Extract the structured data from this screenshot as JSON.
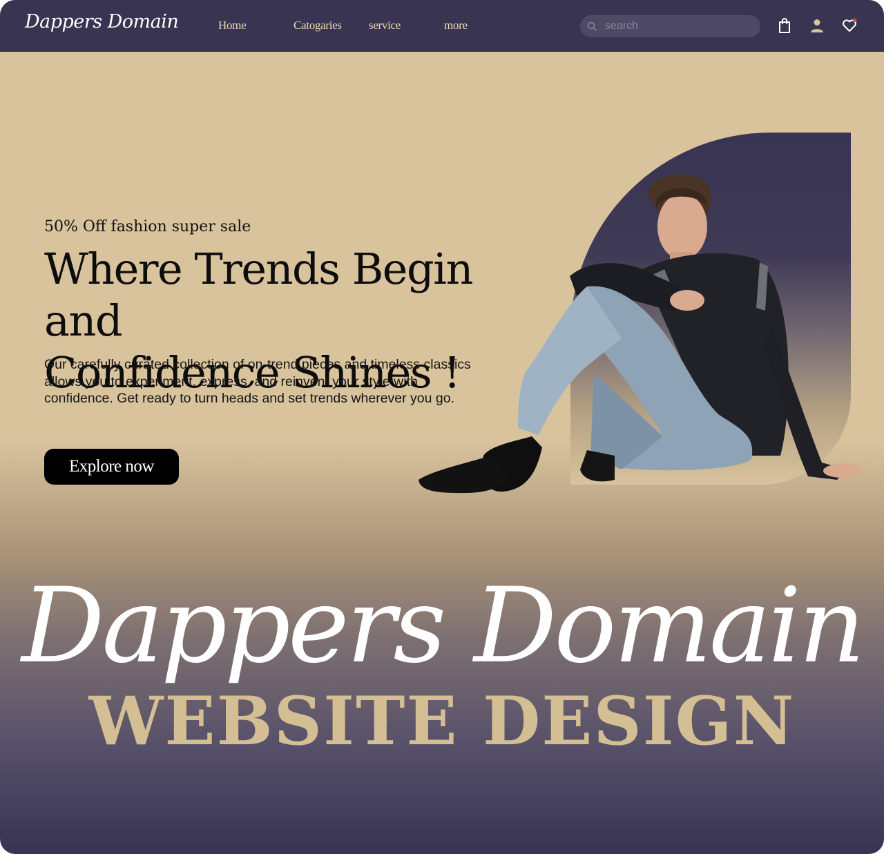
{
  "nav": {
    "logo": "Dappers Domain",
    "links": [
      "Home",
      "Catogaries",
      "service",
      "more"
    ],
    "search_placeholder": "search",
    "icons": [
      "search-icon",
      "shopping-bag-icon",
      "user-icon",
      "heart-icon"
    ],
    "notification_dot_color": "#e53935"
  },
  "hero": {
    "sale_tag": "50% Off fashion super sale",
    "headline_line1": "Where Trends Begin and",
    "headline_line2": "Confidence Shines !",
    "description": "Our carefully curated collection of on-trend pieces and timeless classics allows you to experiment, express, and reinvent your style with confidence. Get ready to turn heads and set trends wherever you go.",
    "cta_label": "Explore now"
  },
  "banner": {
    "title": "Dappers Domain",
    "subtitle": "WEBSITE DESIGN"
  },
  "colors": {
    "navy": "#383451",
    "beige": "#d8c39d",
    "nav_text": "#ecd9b4",
    "subtitle_gold": "#d4be93"
  }
}
